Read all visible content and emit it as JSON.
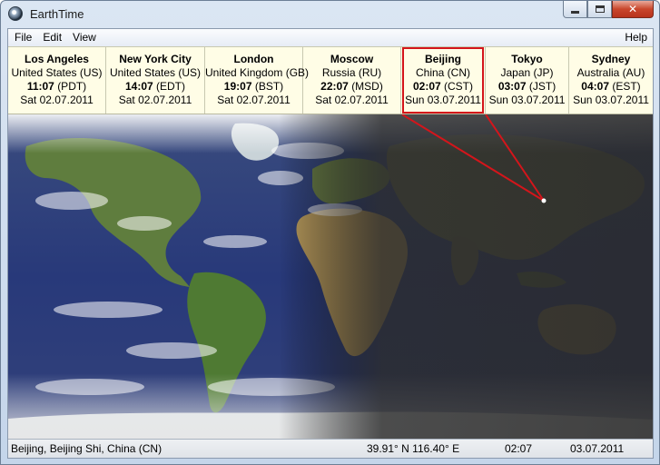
{
  "window": {
    "title": "EarthTime",
    "minimize_icon": "minimize-icon",
    "maximize_icon": "maximize-icon",
    "close_icon": "close-icon",
    "close_glyph": "✕"
  },
  "menu": {
    "file": "File",
    "edit": "Edit",
    "view": "View",
    "help": "Help"
  },
  "cities": [
    {
      "name": "Los Angeles",
      "country": "United States (US)",
      "time": "11:07",
      "zone": "(PDT)",
      "date": "Sat 02.07.2011"
    },
    {
      "name": "New York City",
      "country": "United States (US)",
      "time": "14:07",
      "zone": "(EDT)",
      "date": "Sat 02.07.2011"
    },
    {
      "name": "London",
      "country": "United Kingdom (GB)",
      "time": "19:07",
      "zone": "(BST)",
      "date": "Sat 02.07.2011"
    },
    {
      "name": "Moscow",
      "country": "Russia (RU)",
      "time": "22:07",
      "zone": "(MSD)",
      "date": "Sat 02.07.2011"
    },
    {
      "name": "Beijing",
      "country": "China (CN)",
      "time": "02:07",
      "zone": "(CST)",
      "date": "Sun 03.07.2011"
    },
    {
      "name": "Tokyo",
      "country": "Japan (JP)",
      "time": "03:07",
      "zone": "(JST)",
      "date": "Sun 03.07.2011"
    },
    {
      "name": "Sydney",
      "country": "Australia (AU)",
      "time": "04:07",
      "zone": "(EST)",
      "date": "Sun 03.07.2011"
    }
  ],
  "selected_city": "Beijing",
  "colors": {
    "highlight": "#d4151b",
    "strip_bg": "#fffde6",
    "ocean_day": "#2b3f7a",
    "land_day": "#5d7a3a",
    "night": "#3f3f3f"
  },
  "status": {
    "location": "Beijing, Beijing Shi, China (CN)",
    "coordinates": "39.91° N  116.40° E",
    "time": "02:07",
    "date": "03.07.2011"
  }
}
